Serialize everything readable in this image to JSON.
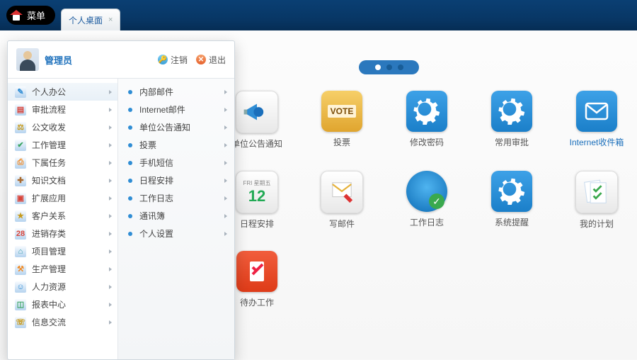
{
  "header": {
    "menu_label": "菜单",
    "tab_label": "个人桌面",
    "tab_close": "×"
  },
  "pager": {
    "active_index": 0,
    "count": 3
  },
  "user": {
    "name": "管理员",
    "logout": "注销",
    "exit": "退出"
  },
  "left_menu": {
    "items": [
      {
        "label": "个人办公",
        "glyph": "✎",
        "klass": "g-blue"
      },
      {
        "label": "审批流程",
        "glyph": "▤",
        "klass": "g-red"
      },
      {
        "label": "公文收发",
        "glyph": "⚖",
        "klass": "g-gold"
      },
      {
        "label": "工作管理",
        "glyph": "✔",
        "klass": "g-green"
      },
      {
        "label": "下属任务",
        "glyph": "⎙",
        "klass": "g-orange"
      },
      {
        "label": "知识文档",
        "glyph": "✚",
        "klass": "g-brown"
      },
      {
        "label": "扩展应用",
        "glyph": "▣",
        "klass": "g-red"
      },
      {
        "label": "客户关系",
        "glyph": "★",
        "klass": "g-gold"
      },
      {
        "label": "进销存类",
        "glyph": "28",
        "klass": "g-red"
      },
      {
        "label": "项目管理",
        "glyph": "⌂",
        "klass": "g-bluegr"
      },
      {
        "label": "生产管理",
        "glyph": "⚒",
        "klass": "g-orange"
      },
      {
        "label": "人力资源",
        "glyph": "☺",
        "klass": "g-blue"
      },
      {
        "label": "报表中心",
        "glyph": "◫",
        "klass": "g-green"
      },
      {
        "label": "信息交流",
        "glyph": "☏",
        "klass": "g-gold"
      }
    ]
  },
  "sub_menu": {
    "items": [
      {
        "label": "内部邮件"
      },
      {
        "label": "Internet邮件"
      },
      {
        "label": "单位公告通知"
      },
      {
        "label": "投票"
      },
      {
        "label": "手机短信"
      },
      {
        "label": "日程安排"
      },
      {
        "label": "工作日志"
      },
      {
        "label": "通讯簿"
      },
      {
        "label": "个人设置"
      }
    ]
  },
  "shortcuts": {
    "row1": [
      {
        "label": "单位公告通知",
        "kind": "megaphone",
        "label_style": "plain"
      },
      {
        "label": "投票",
        "kind": "vote",
        "label_style": "plain"
      },
      {
        "label": "修改密码",
        "kind": "gear",
        "label_style": "plain"
      },
      {
        "label": "常用审批",
        "kind": "gear",
        "label_style": "plain"
      },
      {
        "label": "Internet收件箱",
        "kind": "envelope",
        "label_style": "blue"
      }
    ],
    "row2": [
      {
        "label": "日程安排",
        "kind": "calendar",
        "label_style": "plain"
      },
      {
        "label": "写邮件",
        "kind": "mail-write",
        "label_style": "plain"
      },
      {
        "label": "工作日志",
        "kind": "disc",
        "label_style": "plain"
      },
      {
        "label": "系统提醒",
        "kind": "gear",
        "label_style": "plain"
      },
      {
        "label": "我的计划",
        "kind": "plan",
        "label_style": "plain"
      }
    ],
    "row3": [
      {
        "label": "待办工作",
        "kind": "todo",
        "label_style": "plain"
      }
    ]
  },
  "colors": {
    "brand": "#0a3f73",
    "accent_blue": "#2f8dd4",
    "panel_border": "#cfd7de"
  }
}
